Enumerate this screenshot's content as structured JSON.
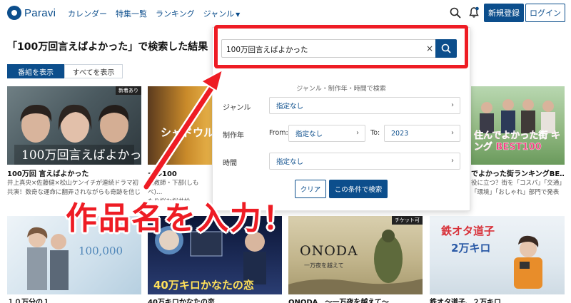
{
  "header": {
    "logo_text": "Paravi",
    "nav": [
      "カレンダー",
      "特集一覧",
      "ランキング",
      "ジャンル"
    ],
    "register_label": "新規登録",
    "login_label": "ログイン"
  },
  "page": {
    "title": "「100万回言えばよかった」で検索した結果",
    "toggle_on": "番組を表示",
    "toggle_off": "すべてを表示"
  },
  "cards": [
    {
      "title": "100万回 言えばよかった",
      "desc": "井上真央×佐藤健×松山ケンイチが連続ドラマ初共演！数奇な運命に翻弄されながらも奇跡を信じ",
      "badge": "新着あり",
      "thumb_text": "100万回言えばよかった"
    },
    {
      "title": "ール100",
      "desc": "元教師・下部(しもべ)…\nたり悩む桜井怜",
      "badge": "",
      "thumb_text": "シャドウル"
    },
    {
      "title": "でよかった街ランキングBE…",
      "desc": "役に立つ？街を「コスパ」「交通」「環境」「おしゃれ」部門で発表",
      "badge": "",
      "thumb_text": "住んでよかった街 キング BEST100"
    },
    {
      "title": "１０万分の１",
      "desc": "",
      "badge": "",
      "thumb_text": "100,000"
    },
    {
      "title": "40万キロかなたの恋",
      "desc": "",
      "badge": "",
      "thumb_text": "40万キロかなたの恋"
    },
    {
      "title": "ONODA　～一万夜を越えて～",
      "desc": "",
      "badge": "チケット可",
      "thumb_text": "ONODA",
      "thumb_sub": "一万夜を越えて"
    },
    {
      "title": "鉄オタ道子、２万キロ",
      "desc": "",
      "badge": "",
      "thumb_text": "鉄オタ道子",
      "thumb_sub": "2万キロ"
    }
  ],
  "search": {
    "query": "100万回言えばよかった",
    "filter_heading": "ジャンル・制作年・時間で検索",
    "genre_label": "ジャンル",
    "genre_value": "指定なし",
    "year_label": "制作年",
    "from_label": "From:",
    "from_value": "指定なし",
    "to_label": "To:",
    "to_value": "2023",
    "time_label": "時間",
    "time_value": "指定なし",
    "clear_label": "クリア",
    "apply_label": "この条件で検索"
  },
  "annotation": {
    "text": "作品名を入力！"
  },
  "colors": {
    "brand": "#0c4e8c",
    "annotation_red": "#ee1c24"
  }
}
